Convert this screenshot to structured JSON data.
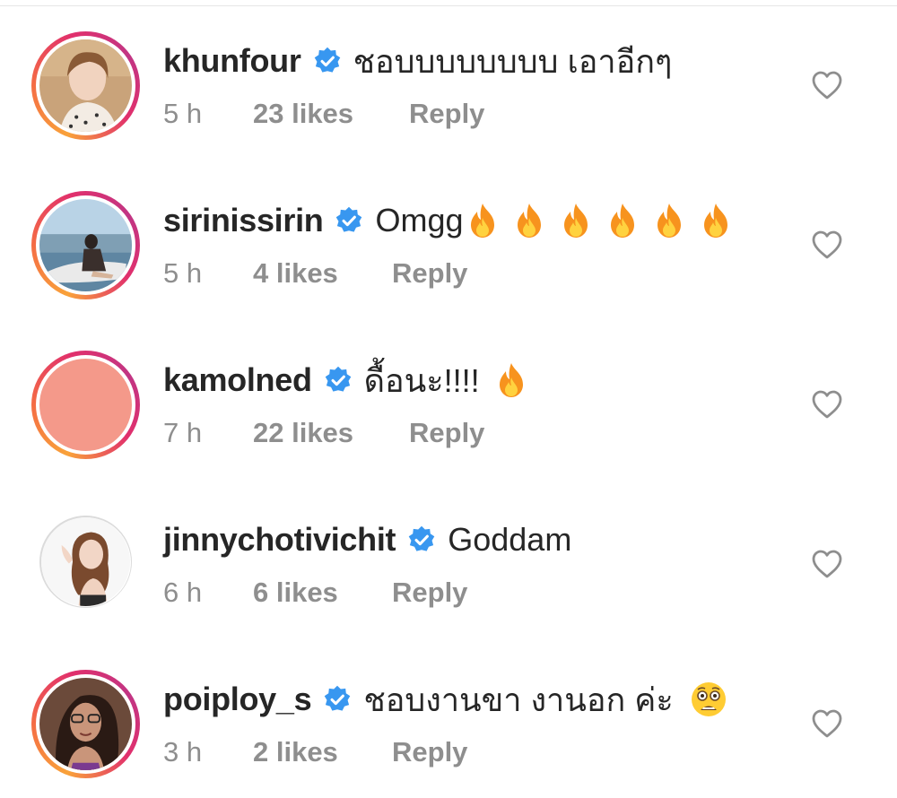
{
  "comments": [
    {
      "username": "khunfour",
      "text": "ชอบบบบบบบบ เอาอีกๆ",
      "emoji_count": 0,
      "time": "5 h",
      "likes": "23 likes",
      "reply": "Reply",
      "verified": true,
      "story_ring": true
    },
    {
      "username": "sirinissirin",
      "text": "Omgg",
      "emoji": "fire",
      "emoji_count": 6,
      "time": "5 h",
      "likes": "4 likes",
      "reply": "Reply",
      "verified": true,
      "story_ring": true
    },
    {
      "username": "kamolned",
      "text": "ดื้อนะ!!!!",
      "emoji": "fire",
      "emoji_count": 1,
      "time": "7 h",
      "likes": "22 likes",
      "reply": "Reply",
      "verified": true,
      "story_ring": true
    },
    {
      "username": "jinnychotivichit",
      "text": "Goddam",
      "emoji_count": 0,
      "time": "6 h",
      "likes": "6 likes",
      "reply": "Reply",
      "verified": true,
      "story_ring": false
    },
    {
      "username": "poiploy_s",
      "text": "ชอบงานขา งานอก ค่ะ",
      "emoji": "fearful-face",
      "emoji_count": 1,
      "time": "3 h",
      "likes": "2 likes",
      "reply": "Reply",
      "verified": true,
      "story_ring": true
    }
  ],
  "icons": {
    "verified": "verified-badge-icon",
    "like": "heart-outline-icon"
  },
  "colors": {
    "username": "#262626",
    "meta": "#8e8e8e",
    "verified": "#3897f0",
    "story_ring_start": "#f9a23a",
    "story_ring_end": "#c13584",
    "kamolned_avatar": "#f4998a"
  }
}
